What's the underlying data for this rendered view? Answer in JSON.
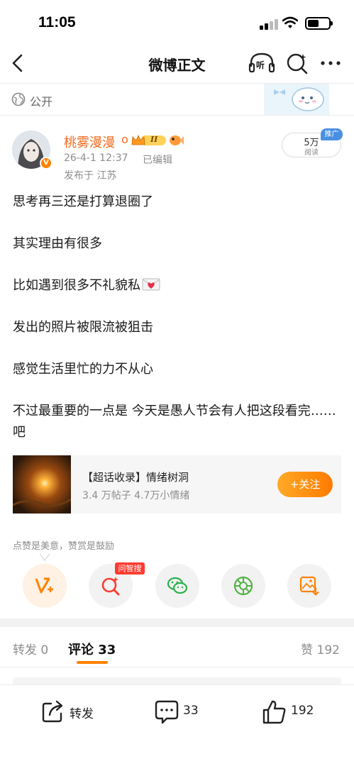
{
  "status_bar": {
    "time": "11:05"
  },
  "nav": {
    "title": "微博正文",
    "listen_label": "听"
  },
  "visibility": {
    "label": "公开"
  },
  "author": {
    "name": "桃雾漫漫",
    "name_suffix": "o",
    "level": "II",
    "verified_badge": "V",
    "date": "26-4-1 12:37",
    "edited": "已编辑",
    "location": "发布于 江苏",
    "read_count": "5万",
    "read_label": "阅读",
    "promo_tag": "推广"
  },
  "post": {
    "paragraphs": [
      "思考再三还是打算退圈了",
      "其实理由有很多",
      "比如遇到很多不礼貌私",
      "发出的照片被限流被狙击",
      "感觉生活里忙的力不从心",
      "不过最重要的一点是 今天是愚人节会有人把这段看完……吧"
    ],
    "emoji_icon": "love-letter-icon"
  },
  "topic": {
    "title": "【超话收录】情绪树洞",
    "stats": "3.4 万帖子 4.7万小情绪",
    "follow_label": "+关注"
  },
  "actions": {
    "hint": "点赞是美意，赞赏是鼓励",
    "wenzhi_badge": "问智搜",
    "icons": [
      "reward-icon",
      "ai-search-icon",
      "wechat-icon",
      "moments-icon",
      "save-image-icon"
    ]
  },
  "tabs": {
    "repost": "转发 0",
    "comments": "评论 33",
    "likes": "赞 192"
  },
  "bottom_bar": {
    "repost_label": "转发",
    "comment_count": "33",
    "like_count": "192"
  },
  "colors": {
    "accent_orange": "#ff8200",
    "author_orange": "#f26a1b",
    "promo_blue": "#4a90e2",
    "badge_red": "#ff3b30"
  }
}
